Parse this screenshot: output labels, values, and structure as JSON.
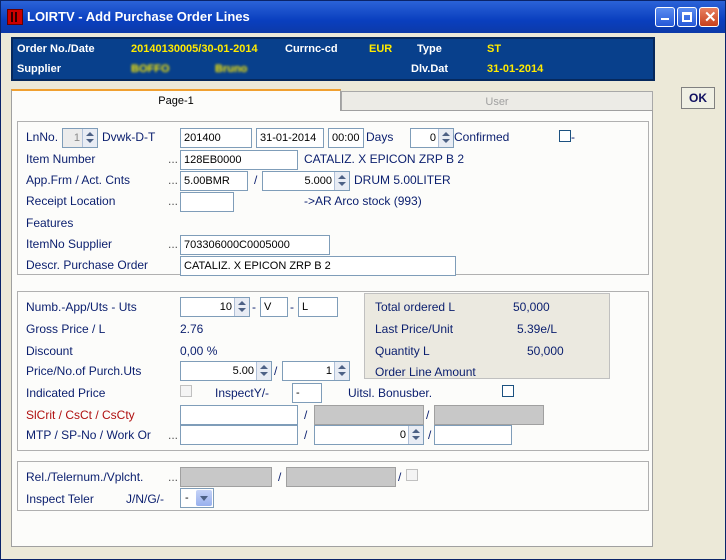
{
  "window": {
    "title": "LOIRTV - Add Purchase Order Lines"
  },
  "header": {
    "order_label": "Order No./Date",
    "order_value": "20140130005/30-01-2014",
    "currency_label": "Currnc-cd",
    "currency_value": "EUR",
    "type_label": "Type",
    "type_value": "ST",
    "supplier_label": "Supplier",
    "supplier_code": "BOFFO",
    "supplier_name": "Bruno",
    "dlvdat_label": "Dlv.Dat",
    "dlvdat_value": "31-01-2014"
  },
  "ok_label": "OK",
  "tabs": [
    {
      "label": "Page-1"
    },
    {
      "label": "User"
    }
  ],
  "line": {
    "lnno_label": "LnNo.",
    "lnno_value": "1",
    "dvwk_label": "Dvwk-D-T",
    "dvwk_value": "201400",
    "date_value": "31-01-2014",
    "time_value": "00:00",
    "days_label": "Days",
    "days_value": "0",
    "confirmed_label": "Confirmed",
    "confirmed_suffix": "-",
    "item_label": "Item Number",
    "item_value": "128EB0000",
    "item_desc": "CATALIZ. X EPICON ZRP B 2",
    "appfrm_label": "App.Frm / Act. Cnts",
    "appfrm_value": "5.00BMR",
    "slash": "/",
    "actcnts_value": "5.000",
    "unit_desc": "DRUM 5.00LITER",
    "receipt_label": "Receipt Location",
    "receipt_value": "",
    "receipt_desc": "->AR Arco stock (993)",
    "features_label": "Features",
    "itemsup_label": "ItemNo Supplier",
    "itemsup_value": "703306000C0005000",
    "descr_label": "Descr. Purchase Order",
    "descr_value": "CATALIZ. X EPICON ZRP B 2",
    "dots": "..."
  },
  "price": {
    "numb_label": "Numb.-App/Uts - Uts",
    "numb_value": "10",
    "dash": "-",
    "v_value": "V",
    "l_value": "L",
    "gross_label": "Gross Price / L",
    "gross_value": "2.76",
    "discount_label": "Discount",
    "discount_value": "0,00 %",
    "ppno_label": "Price/No.of Purch.Uts",
    "ppno_value1": "5.00",
    "ppno_value2": "1",
    "indicated_label": "Indicated Price",
    "inspect_label": "InspectY/-",
    "inspect_value": "-",
    "uitsl_label": "Uitsl. Bonusber.",
    "slcrit_label": "SlCrit / CsCt / CsCty",
    "mtp_label": "MTP / SP-No / Work Or",
    "mtp_mid_value": "0",
    "summary": {
      "total_label": "Total ordered  L",
      "total_value": "50,000",
      "last_label": "Last Price/Unit",
      "last_value": "5.39e/L",
      "qty_label": "Quantity L",
      "qty_value": "50,000",
      "amount_label": "Order Line Amount"
    }
  },
  "rel": {
    "rel_label": "Rel./Telernum./Vplcht.",
    "inspect_teler_label": "Inspect Teler",
    "jng_label": "J/N/G/-",
    "jng_value": "-"
  },
  "colors": {
    "title_bar": "#0a3fbf",
    "header_bg": "#08408c",
    "header_value": "#ffea00",
    "label_text": "#0a1e6e",
    "required_label": "#b01010"
  }
}
